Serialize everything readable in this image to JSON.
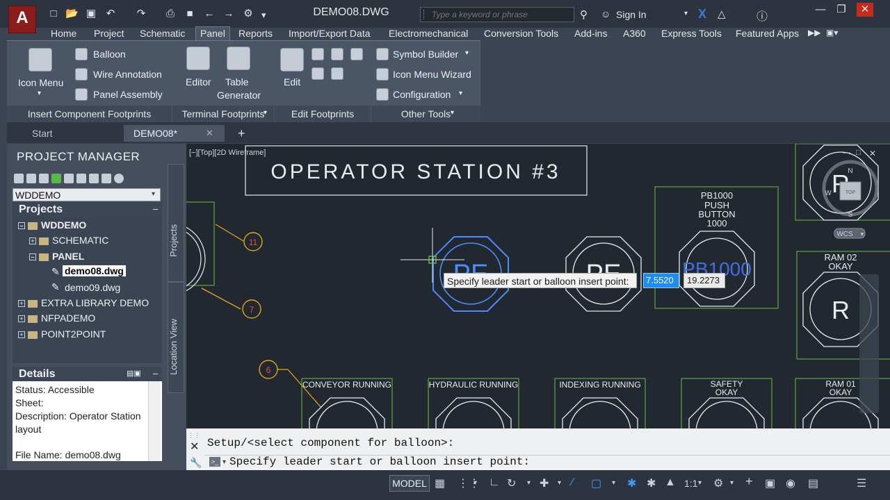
{
  "app": {
    "logo_letter": "A",
    "document_title": "DEMO08.DWG",
    "search_placeholder": "Type a keyword or phrase",
    "sign_in": "Sign In"
  },
  "ribbon_tabs": [
    "Home",
    "Project",
    "Schematic",
    "Panel",
    "Reports",
    "Import/Export Data",
    "Electromechanical",
    "Conversion Tools",
    "Add-ins",
    "A360",
    "Express Tools",
    "Featured Apps"
  ],
  "active_ribbon_tab": "Panel",
  "ribbon": {
    "insert_footprints": {
      "title": "Insert Component Footprints",
      "icon_menu": "Icon Menu",
      "balloon": "Balloon",
      "wire_annotation": "Wire Annotation",
      "panel_assembly": "Panel Assembly"
    },
    "terminal_footprints": {
      "title": "Terminal Footprints",
      "editor": "Editor",
      "table_generator_1": "Table",
      "table_generator_2": "Generator"
    },
    "edit_footprints": {
      "title": "Edit Footprints",
      "edit": "Edit"
    },
    "other_tools": {
      "title": "Other Tools",
      "symbol_builder": "Symbol Builder",
      "icon_menu_wizard": "Icon Menu  Wizard",
      "configuration": "Configuration"
    }
  },
  "doc_tabs": {
    "start": "Start",
    "demo08": "DEMO08*"
  },
  "project_manager": {
    "title": "PROJECT MANAGER",
    "selected_project": "WDDEMO",
    "projects_header": "Projects",
    "tree": {
      "wddemo": "WDDEMO",
      "schematic": "SCHEMATIC",
      "panel": "PANEL",
      "demo08": "demo08.dwg",
      "demo09": "demo09.dwg",
      "extra": "EXTRA LIBRARY DEMO",
      "nfpa": "NFPADEMO",
      "p2p": "POINT2POINT"
    },
    "details_header": "Details",
    "details": {
      "status": "Status: Accessible",
      "sheet": "Sheet:",
      "description_1": "Description: Operator Station",
      "description_2": "layout",
      "file_name": "File Name: demo08.dwg"
    },
    "side_tab_projects": "Projects",
    "side_tab_location": "Location View"
  },
  "drawing": {
    "viewport_label": "[−][Top][2D Wireframe]",
    "title": "OPERATOR STATION #3",
    "pb_label_1": "PB1000",
    "pb_label_2": "PUSH",
    "pb_label_3": "BUTTON",
    "pb_label_4": "1000",
    "pb_text": "PB1000",
    "pe_text_1": "PE",
    "pe_text_2": "PE",
    "ram02_1": "RAM  02",
    "ram02_2": "OKAY",
    "ram01_1": "RAM  01",
    "ram01_2": "OKAY",
    "r_text_1": "R",
    "r_text_2": "R",
    "conveyor": "CONVEYOR  RUNNING",
    "hydraulic": "HYDRAULIC  RUNNING",
    "indexing": "INDEXING  RUNNING",
    "safety_1": "SAFETY",
    "safety_2": "OKAY",
    "balloon_11": "11",
    "balloon_7": "7",
    "balloon_6": "6",
    "compass_n": "N",
    "compass_w": "W",
    "compass_s": "S",
    "compass_top": "TOP",
    "wcs": "WCS"
  },
  "tooltip": {
    "prompt": "Specify leader start or balloon insert point:",
    "x": "7.5520",
    "y": "19.2273"
  },
  "command": {
    "history": "Setup/<select component for balloon>:",
    "input": "Specify leader start or balloon insert point:"
  },
  "status": {
    "model": "MODEL",
    "scale": "1:1"
  },
  "colors": {
    "canvas": "#212830",
    "green_line": "#6fbf3f",
    "selected": "#4d8cff",
    "balloon": "#e0a526",
    "text": "#e9ecef"
  }
}
